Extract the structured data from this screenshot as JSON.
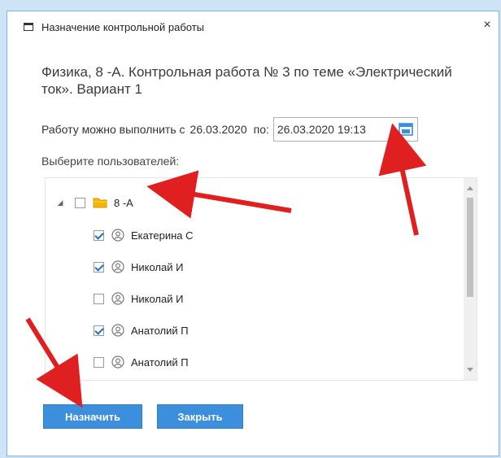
{
  "window": {
    "title": "Назначение контрольной работы",
    "close_glyph": "×"
  },
  "test": {
    "title": "Физика, 8 -А. Контрольная работа № 3 по теме «Электрический ток». Вариант 1"
  },
  "dates": {
    "label_prefix": "Работу можно выполнить с",
    "start_date": "26.03.2020",
    "label_to": "по:",
    "end_datetime": "26.03.2020 19:13"
  },
  "users": {
    "label": "Выберите пользователей:",
    "group": {
      "name": "8 -А",
      "checked": false,
      "expanded": true
    },
    "items": [
      {
        "name": "Екатерина С",
        "checked": true
      },
      {
        "name": "Николай И",
        "checked": true
      },
      {
        "name": "Николай И",
        "checked": false
      },
      {
        "name": "Анатолий П",
        "checked": true
      },
      {
        "name": "Анатолий П",
        "checked": false
      }
    ]
  },
  "buttons": {
    "assign": "Назначить",
    "close": "Закрыть"
  },
  "icons": {
    "window": "window-icon",
    "close": "close-icon",
    "calendar": "calendar-icon",
    "folder": "folder-icon",
    "user": "user-icon",
    "expander": "collapse-triangle-icon"
  },
  "colors": {
    "button": "#3b8fdc",
    "button_border": "#2b7fc4",
    "checkmark": "#1f6fc2",
    "folder": "#f2b705",
    "annotation_arrow": "#e02020",
    "dialog_border": "#7fb6ea"
  }
}
